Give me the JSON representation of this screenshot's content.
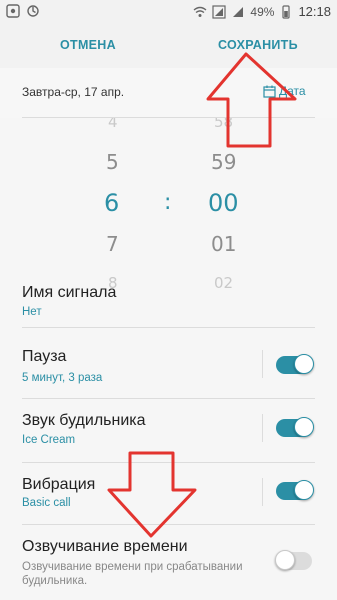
{
  "status_bar": {
    "battery": "49%",
    "time": "12:18"
  },
  "action_bar": {
    "cancel_label": "ОТМЕНА",
    "save_label": "СОХРАНИТЬ"
  },
  "date_row": {
    "text": "Завтра-ср, 17 апр.",
    "link_label": "Дата"
  },
  "picker": {
    "hours": [
      "4",
      "5",
      "6",
      "7",
      "8"
    ],
    "minutes": [
      "58",
      "59",
      "00",
      "01",
      "02"
    ],
    "separator": ":",
    "selected_hour": "6",
    "selected_minute": "00"
  },
  "settings": {
    "alarm_name": {
      "title": "Имя сигнала",
      "value": "Нет"
    },
    "snooze": {
      "title": "Пауза",
      "value": "5 минут, 3 раза",
      "enabled": true
    },
    "sound": {
      "title": "Звук будильника",
      "value": "Ice Cream",
      "enabled": true
    },
    "vibration": {
      "title": "Вибрация",
      "value": "Basic call",
      "enabled": true
    },
    "voice": {
      "title": "Озвучивание времени",
      "description": "Озвучивание времени при срабатывании будильника.",
      "enabled": false
    }
  },
  "colors": {
    "accent": "#2b8fa5",
    "annotation": "#e3342f"
  }
}
